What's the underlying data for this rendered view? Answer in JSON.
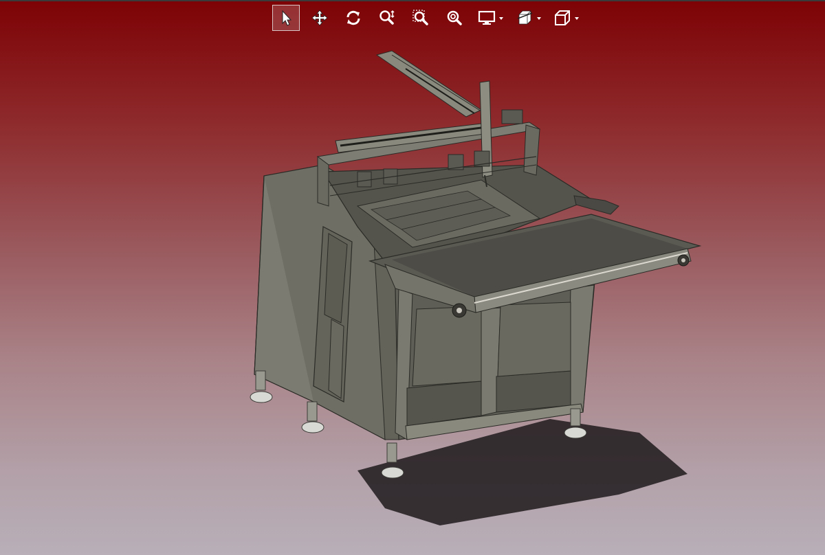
{
  "window": {
    "title": ""
  },
  "toolbar": {
    "items": [
      {
        "name": "select-tool",
        "icon": "select-arrow-icon",
        "active": true
      },
      {
        "name": "pan-tool",
        "icon": "pan-icon",
        "active": false
      },
      {
        "name": "rotate-tool",
        "icon": "rotate-icon",
        "active": false
      },
      {
        "name": "zoom-tool",
        "icon": "zoom-icon",
        "active": false
      },
      {
        "name": "zoom-window-tool",
        "icon": "zoom-window-icon",
        "active": false
      },
      {
        "name": "zoom-fit-tool",
        "icon": "zoom-fit-icon",
        "active": false
      },
      {
        "name": "display-mode-dropdown",
        "icon": "monitor-icon",
        "active": false
      },
      {
        "name": "section-view-dropdown",
        "icon": "section-icon",
        "active": false
      },
      {
        "name": "view-orientation-dropdown",
        "icon": "cube-icon",
        "active": false
      }
    ]
  },
  "scene": {
    "background_top": "#7d0205",
    "background_bottom": "#b8afb8",
    "model_color": "#6f6e64",
    "model_edge_color": "#2a2a26",
    "shadow_color": "#1e1a1c"
  }
}
